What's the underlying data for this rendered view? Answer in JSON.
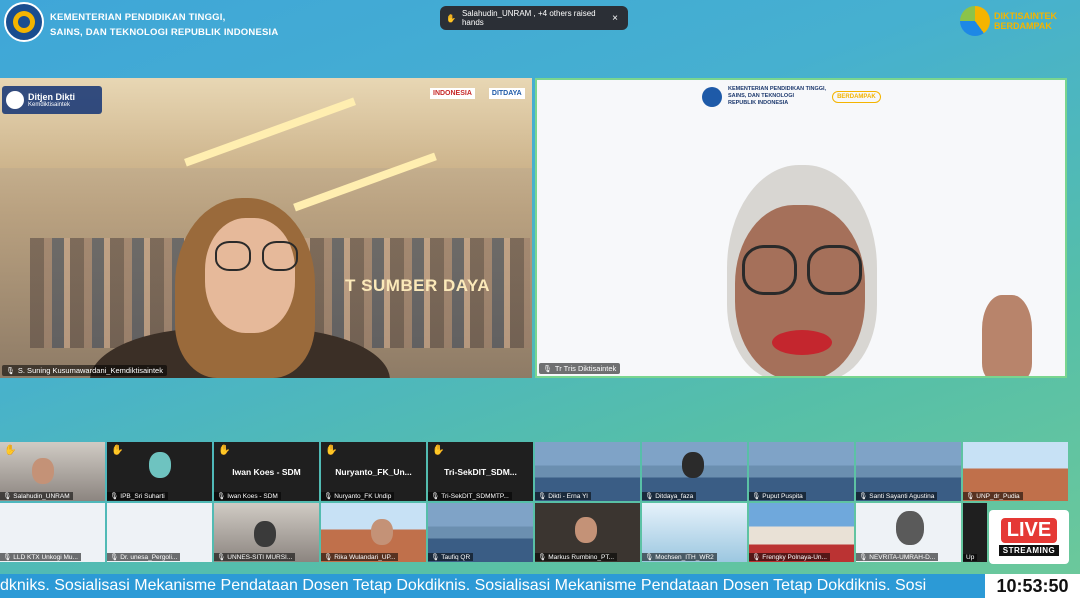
{
  "header": {
    "ministry_line1": "KEMENTERIAN PENDIDIKAN TINGGI,",
    "ministry_line2": "SAINS, DAN TEKNOLOGI REPUBLIK INDONESIA",
    "raised_hands": "Salahudin_UNRAM , +4 others raised hands",
    "close_symbol": "×",
    "brand_right_1": "DIKTISAINTEK",
    "brand_right_2": "BERDAMPAK"
  },
  "main_tiles": {
    "left": {
      "badge_title": "Ditjen Dikti",
      "badge_sub": "Kemdiktisaintek",
      "logo_a": "INDONESIA",
      "logo_b": "DITDAYA",
      "banner": "T SUMBER DAYA",
      "name": "S. Suning Kusumawardani_Kemdiktisaintek"
    },
    "right": {
      "header_line1": "KEMENTERIAN PENDIDIKAN TINGGI,",
      "header_line2": "SAINS, DAN TEKNOLOGI",
      "header_line3": "REPUBLIK INDONESIA",
      "badge": "BERDAMPAK",
      "name": "Tr Tris Diktisaintek"
    }
  },
  "gallery": {
    "row1": [
      {
        "label": "Salahudin_UNRAM",
        "hand": true
      },
      {
        "label": "IPB_Sri Suharti",
        "hand": true
      },
      {
        "label": "Iwan Koes - SDM",
        "title": "Iwan Koes - SDM",
        "hand": true
      },
      {
        "label": "Nuryanto_FK Undip",
        "title": "Nuryanto_FK_Un...",
        "hand": true
      },
      {
        "label": "Tri-SekDIT_SDMMTP...",
        "title": "Tri-SekDIT_SDM...",
        "hand": true
      },
      {
        "label": "Dikti - Erna Yl"
      },
      {
        "label": "Ditdaya_faza"
      },
      {
        "label": "Puput Puspita"
      },
      {
        "label": "Santi Sayanti Agustina"
      },
      {
        "label": "UNP_dr_Pudia"
      }
    ],
    "row2": [
      {
        "label": "LLD KTX Unkogi Mu..."
      },
      {
        "label": "Dr. unesa_Pergoli..."
      },
      {
        "label": "UNNES-SITI MURSI..."
      },
      {
        "label": "Rika Wulandari_UP..."
      },
      {
        "label": "Taufiq QR"
      },
      {
        "label": "Markus Rumbino_PT..."
      },
      {
        "label": "Mochsen_ITH_WR2"
      },
      {
        "label": "Frengky Polnaya-Un..."
      },
      {
        "label": "NEVRITA-UMRAH-D..."
      },
      {
        "label": "Up"
      }
    ]
  },
  "live": {
    "line1": "LIVE",
    "line2": "STREAMING"
  },
  "ticker": "dkniks.  Sosialisasi Mekanisme Pendataan Dosen Tetap Dokdiknis.  Sosialisasi Mekanisme Pendataan Dosen Tetap Dokdiknis.  Sosi",
  "clock": "10:53:50"
}
